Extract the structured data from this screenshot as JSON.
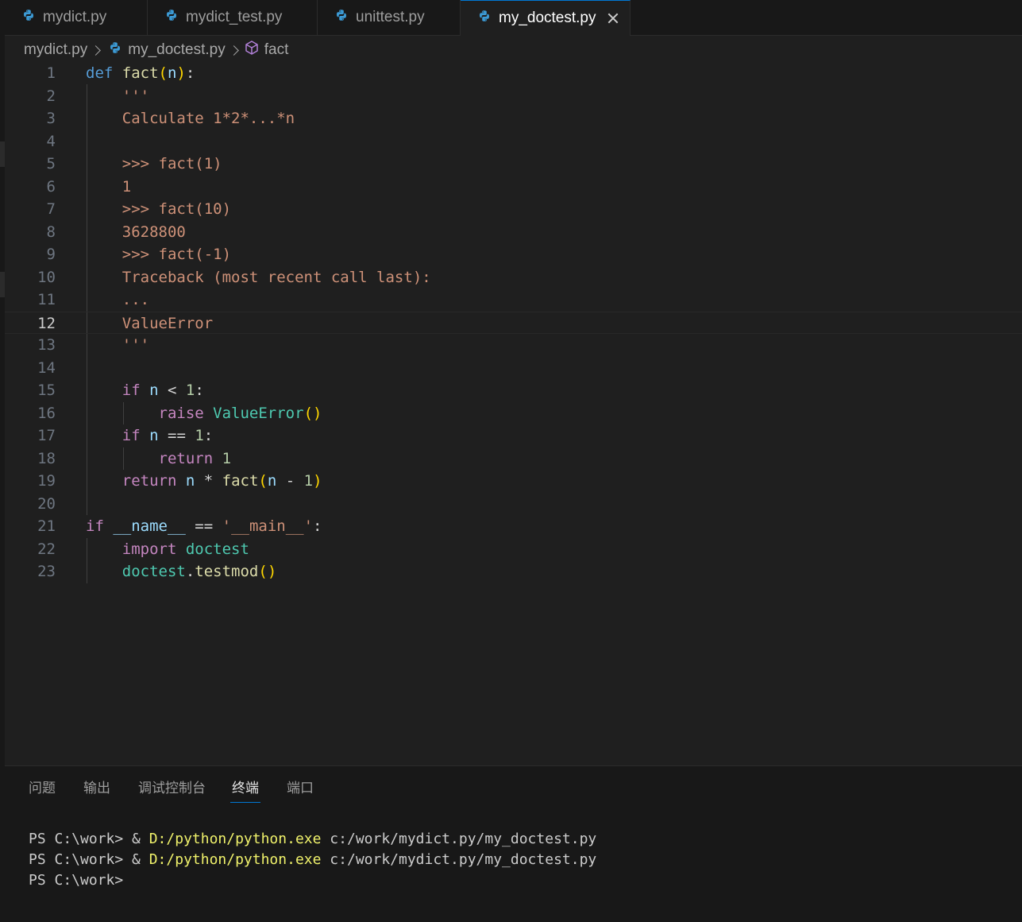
{
  "tabs": [
    {
      "label": "mydict.py",
      "active": false
    },
    {
      "label": "mydict_test.py",
      "active": false
    },
    {
      "label": "unittest.py",
      "active": false
    },
    {
      "label": "my_doctest.py",
      "active": true
    }
  ],
  "breadcrumb": {
    "folder": "mydict.py",
    "file": "my_doctest.py",
    "symbol": "fact"
  },
  "editor": {
    "current_line": 12,
    "lines": [
      [
        [
          "kw",
          "def"
        ],
        [
          "op",
          " "
        ],
        [
          "fn",
          "fact"
        ],
        [
          "p1",
          "("
        ],
        [
          "var",
          "n"
        ],
        [
          "p1",
          ")"
        ],
        [
          "op",
          ":"
        ]
      ],
      [
        [
          "op",
          "    "
        ],
        [
          "str",
          "'''"
        ]
      ],
      [
        [
          "op",
          "    "
        ],
        [
          "str",
          "Calculate 1*2*...*n"
        ]
      ],
      [],
      [
        [
          "op",
          "    "
        ],
        [
          "str",
          ">>> fact(1)"
        ]
      ],
      [
        [
          "op",
          "    "
        ],
        [
          "str",
          "1"
        ]
      ],
      [
        [
          "op",
          "    "
        ],
        [
          "str",
          ">>> fact(10)"
        ]
      ],
      [
        [
          "op",
          "    "
        ],
        [
          "str",
          "3628800"
        ]
      ],
      [
        [
          "op",
          "    "
        ],
        [
          "str",
          ">>> fact(-1)"
        ]
      ],
      [
        [
          "op",
          "    "
        ],
        [
          "str",
          "Traceback (most recent call last):"
        ]
      ],
      [
        [
          "op",
          "    "
        ],
        [
          "str",
          "..."
        ]
      ],
      [
        [
          "op",
          "    "
        ],
        [
          "str",
          "ValueError"
        ]
      ],
      [
        [
          "op",
          "    "
        ],
        [
          "str",
          "'''"
        ]
      ],
      [],
      [
        [
          "op",
          "    "
        ],
        [
          "ctl",
          "if"
        ],
        [
          "op",
          " "
        ],
        [
          "var",
          "n"
        ],
        [
          "op",
          " < "
        ],
        [
          "num",
          "1"
        ],
        [
          "op",
          ":"
        ]
      ],
      [
        [
          "op",
          "        "
        ],
        [
          "ctl",
          "raise"
        ],
        [
          "op",
          " "
        ],
        [
          "cls",
          "ValueError"
        ],
        [
          "p1",
          "()"
        ]
      ],
      [
        [
          "op",
          "    "
        ],
        [
          "ctl",
          "if"
        ],
        [
          "op",
          " "
        ],
        [
          "var",
          "n"
        ],
        [
          "op",
          " == "
        ],
        [
          "num",
          "1"
        ],
        [
          "op",
          ":"
        ]
      ],
      [
        [
          "op",
          "        "
        ],
        [
          "ctl",
          "return"
        ],
        [
          "op",
          " "
        ],
        [
          "num",
          "1"
        ]
      ],
      [
        [
          "op",
          "    "
        ],
        [
          "ctl",
          "return"
        ],
        [
          "op",
          " "
        ],
        [
          "var",
          "n"
        ],
        [
          "op",
          " * "
        ],
        [
          "fn",
          "fact"
        ],
        [
          "p1",
          "("
        ],
        [
          "var",
          "n"
        ],
        [
          "op",
          " - "
        ],
        [
          "num",
          "1"
        ],
        [
          "p1",
          ")"
        ]
      ],
      [],
      [
        [
          "ctl",
          "if"
        ],
        [
          "op",
          " "
        ],
        [
          "var",
          "__name__"
        ],
        [
          "op",
          " == "
        ],
        [
          "str",
          "'__main__'"
        ],
        [
          "op",
          ":"
        ]
      ],
      [
        [
          "op",
          "    "
        ],
        [
          "ctl",
          "import"
        ],
        [
          "op",
          " "
        ],
        [
          "cls",
          "doctest"
        ]
      ],
      [
        [
          "op",
          "    "
        ],
        [
          "cls",
          "doctest"
        ],
        [
          "op",
          "."
        ],
        [
          "fn",
          "testmod"
        ],
        [
          "p1",
          "()"
        ]
      ]
    ]
  },
  "panel": {
    "tabs": [
      {
        "label": "问题",
        "active": false
      },
      {
        "label": "输出",
        "active": false
      },
      {
        "label": "调试控制台",
        "active": false
      },
      {
        "label": "终端",
        "active": true
      },
      {
        "label": "端口",
        "active": false
      }
    ],
    "terminal": [
      {
        "prompt": "PS C:\\work> & ",
        "exe": "D:/python/python.exe",
        "args": " c:/work/mydict.py/my_doctest.py"
      },
      {
        "prompt": "PS C:\\work> & ",
        "exe": "D:/python/python.exe",
        "args": " c:/work/mydict.py/my_doctest.py"
      },
      {
        "prompt": "PS C:\\work>",
        "exe": "",
        "args": ""
      }
    ]
  },
  "colors": {
    "accent": "#0078d4",
    "python_icon": "#3c9bd6",
    "symbol_icon": "#b180d7"
  }
}
